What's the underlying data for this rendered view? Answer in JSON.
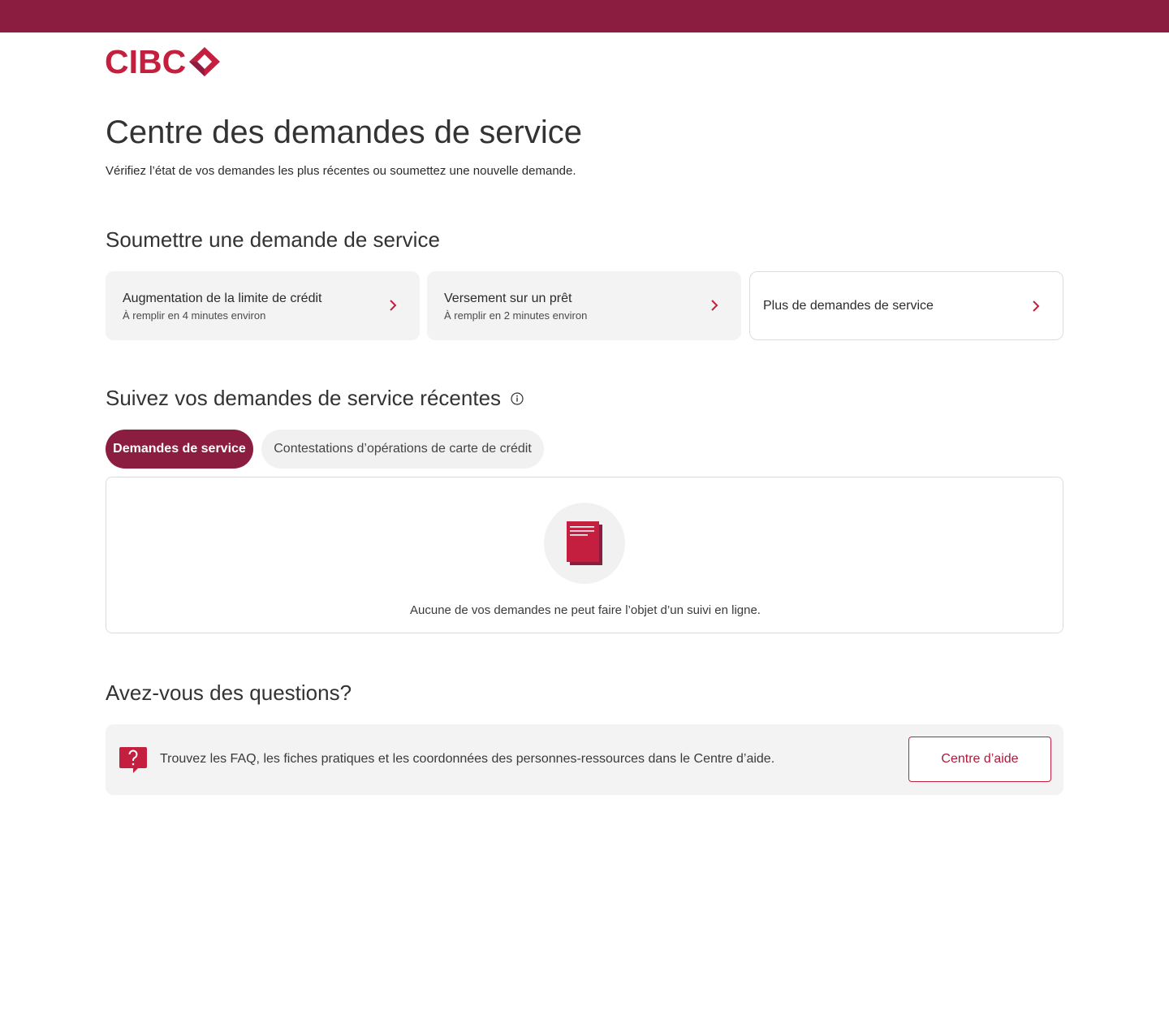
{
  "brand": {
    "logo_text": "CIBC",
    "primary_color": "#8b1d41",
    "accent_red": "#c41f3e"
  },
  "header": {
    "title": "Centre des demandes de service",
    "subtitle": "Vérifiez l’état de vos demandes les plus récentes ou soumettez une nouvelle demande."
  },
  "submit_section": {
    "title": "Soumettre une demande de service",
    "cards": [
      {
        "title": "Augmentation de la limite de crédit",
        "subtitle": "À remplir en 4 minutes environ",
        "icon": "chevron-right-icon"
      },
      {
        "title": "Versement sur un prêt",
        "subtitle": "À remplir en 2 minutes environ",
        "icon": "chevron-right-icon"
      },
      {
        "title": "Plus de demandes de service",
        "icon": "chevron-right-icon"
      }
    ]
  },
  "track_section": {
    "title": "Suivez vos demandes de service récentes",
    "info_icon": "info-icon",
    "tabs": [
      {
        "label": "Demandes de service",
        "selected": true
      },
      {
        "label": "Contestations d’opérations de carte de crédit",
        "selected": false
      }
    ],
    "empty_state": {
      "icon": "document-icon",
      "message": "Aucune de vos demandes ne peut faire l’objet d’un suivi en ligne."
    }
  },
  "questions_section": {
    "title": "Avez-vous des questions?",
    "icon": "help-question-icon",
    "text": "Trouvez les FAQ, les fiches pratiques et les coordonnées des personnes-ressources dans le Centre d’aide.",
    "button_label": "Centre d’aide"
  }
}
